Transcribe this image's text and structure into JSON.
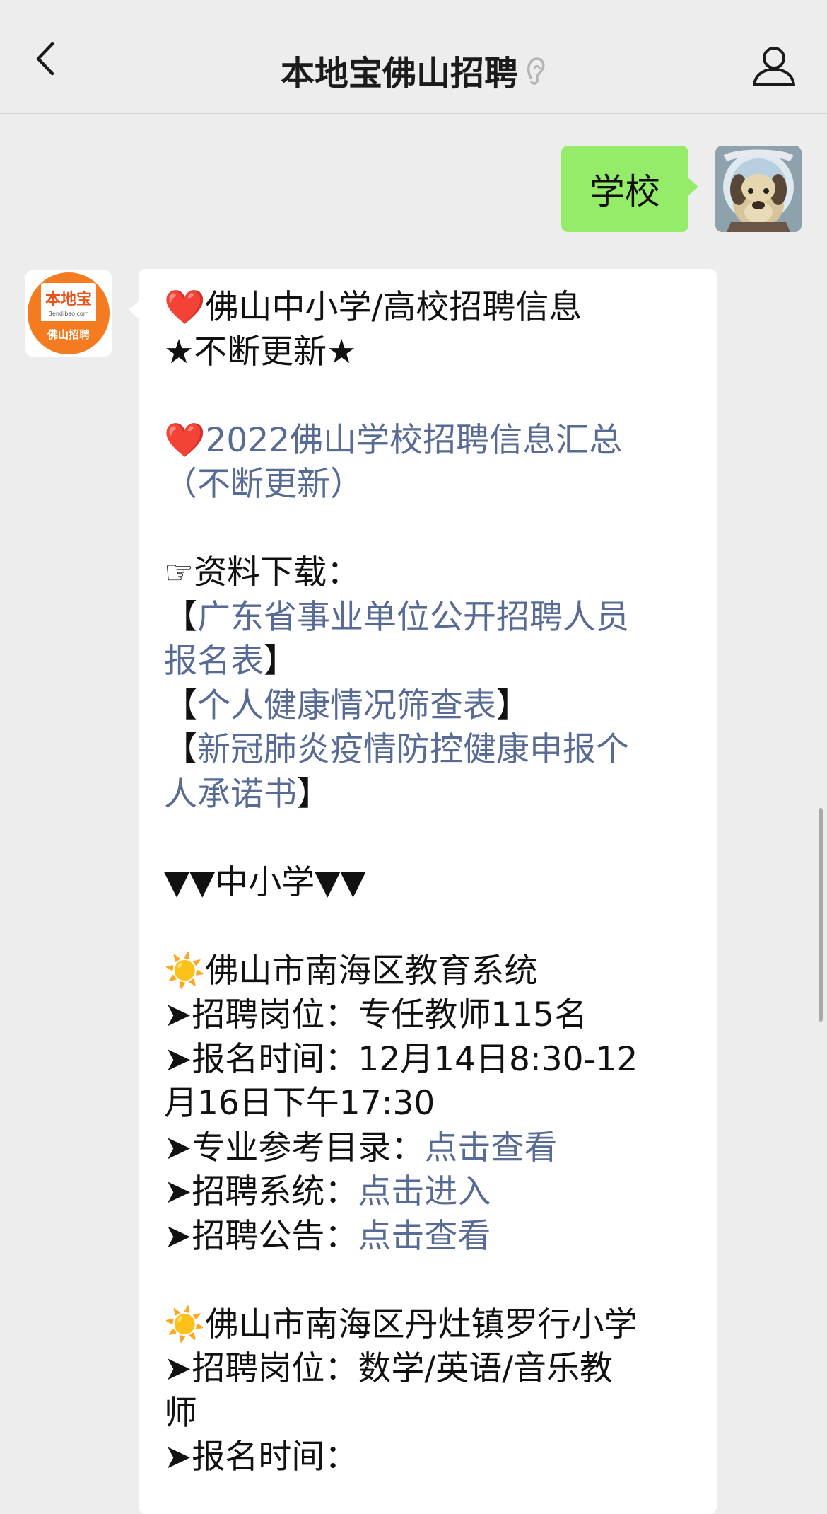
{
  "header": {
    "title": "本地宝佛山招聘"
  },
  "icons": {
    "back": "chevron-left-icon",
    "ear": "ear-icon",
    "profile": "person-icon"
  },
  "colors": {
    "link": "#576b95",
    "outgoing_bubble": "#95ec69",
    "logo_orange": "#f47b20"
  },
  "outgoing_message": {
    "text": "学校"
  },
  "bot_avatar": {
    "line1": "本地宝",
    "line2": "Bendibao.com",
    "line3": "佛山招聘"
  },
  "message": {
    "title_line1": "❤️佛山中小学/高校招聘信息",
    "title_line2": "★不断更新★",
    "summary_prefix": "❤️",
    "summary_link_1": "2022佛山学校招聘信息汇总",
    "summary_link_2": "（不断更新）",
    "downloads_label": "☞资料下载：",
    "download_1_open": "【",
    "download_1_text_a": "广东省事业单位公开招聘人员",
    "download_1_text_b": "报名表",
    "download_1_close": "】",
    "download_2_open": "【",
    "download_2_text": "个人健康情况筛查表",
    "download_2_close": "】",
    "download_3_open": "【",
    "download_3_text_a": "新冠肺炎疫情防控健康申报个",
    "download_3_text_b": "人承诺书",
    "download_3_close": "】",
    "section_primary": "▼▼中小学▼▼",
    "school_1": {
      "name": "☀️佛山市南海区教育系统",
      "positions": "➤招聘岗位：专任教师115名",
      "time_a": "➤报名时间：12月14日8:30-12",
      "time_b": "月16日下午17:30",
      "catalog_label": "➤专业参考目录：",
      "catalog_link": "点击查看",
      "system_label": "➤招聘系统：",
      "system_link": "点击进入",
      "notice_label": "➤招聘公告：",
      "notice_link": "点击查看"
    },
    "school_2": {
      "name": "☀️佛山市南海区丹灶镇罗行小学",
      "positions_a": "➤招聘岗位：数学/英语/音乐教",
      "positions_b": "师",
      "time_label": "➤报名时间："
    }
  }
}
